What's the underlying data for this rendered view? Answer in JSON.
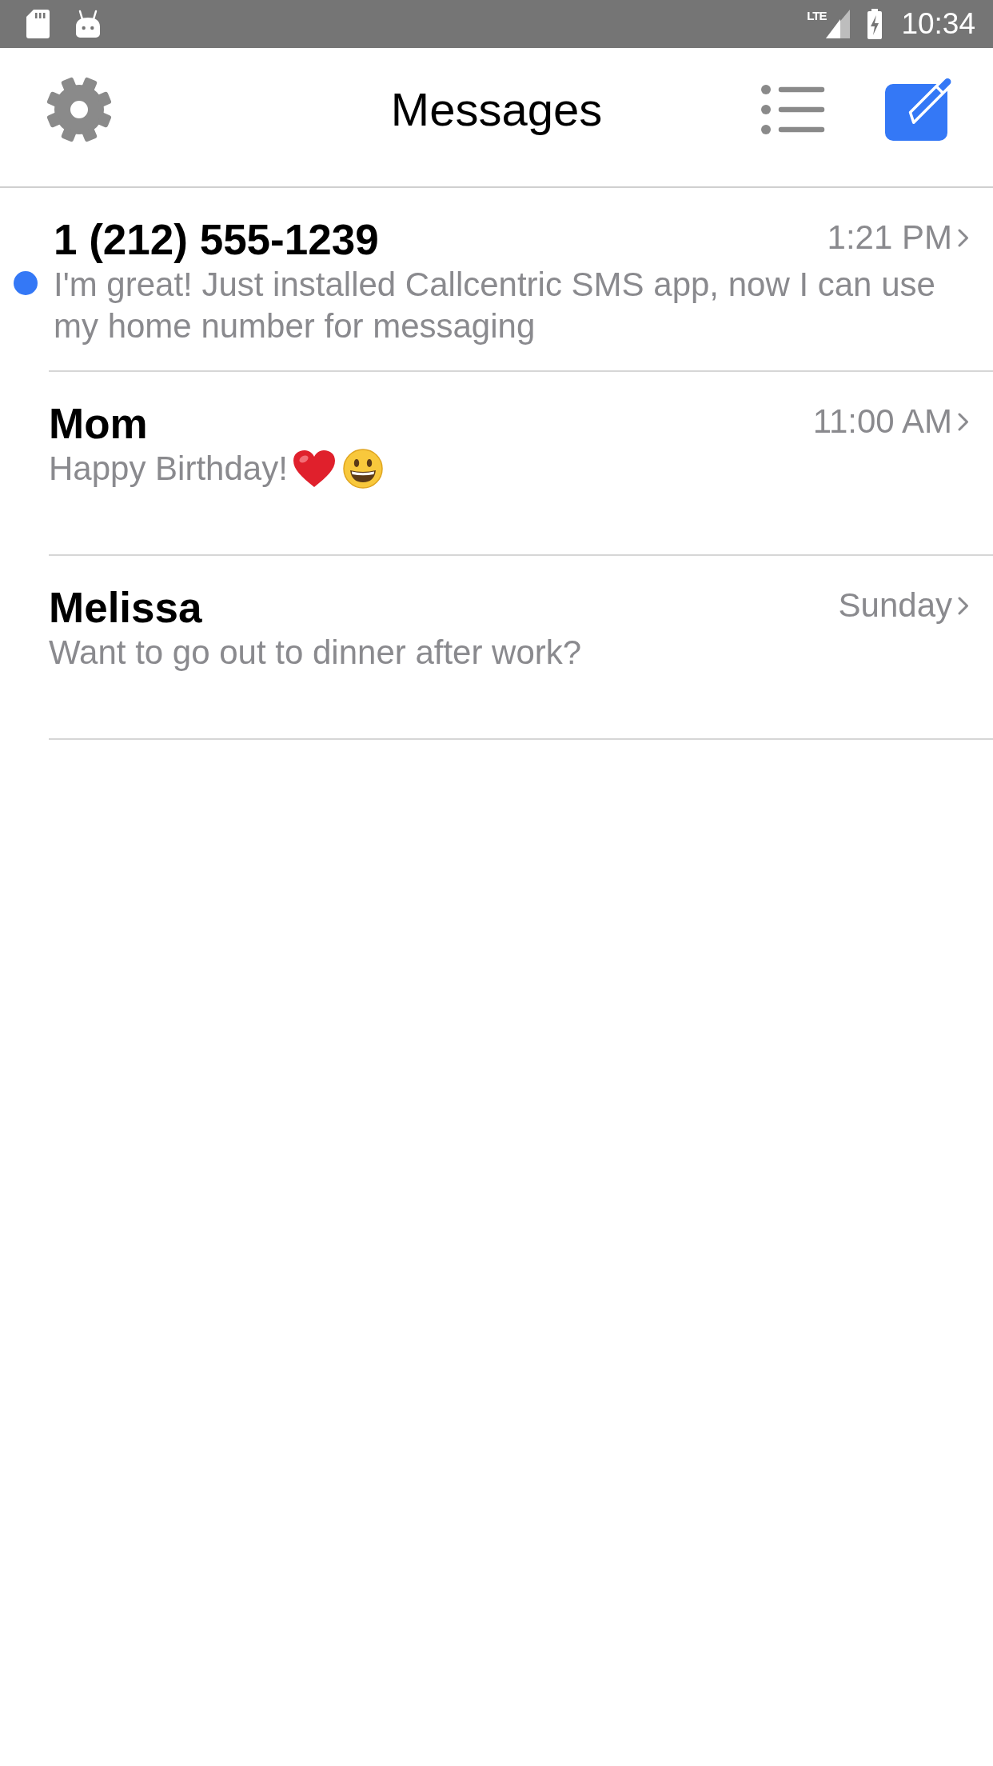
{
  "status_bar": {
    "network": "LTE",
    "time": "10:34"
  },
  "header": {
    "title": "Messages"
  },
  "conversations": [
    {
      "name": "1 (212) 555-1239",
      "time": "1:21 PM",
      "preview": "I'm great! Just installed Callcentric SMS app, now I can use my home number for messaging",
      "unread": true
    },
    {
      "name": "Mom",
      "time": "11:00 AM",
      "preview": "Happy Birthday!",
      "emojis": [
        {
          "kind": "heart"
        },
        {
          "kind": "grinning_face"
        }
      ],
      "unread": false
    },
    {
      "name": "Melissa",
      "time": "Sunday",
      "preview": "Want to go out to dinner after work?",
      "unread": false
    }
  ]
}
